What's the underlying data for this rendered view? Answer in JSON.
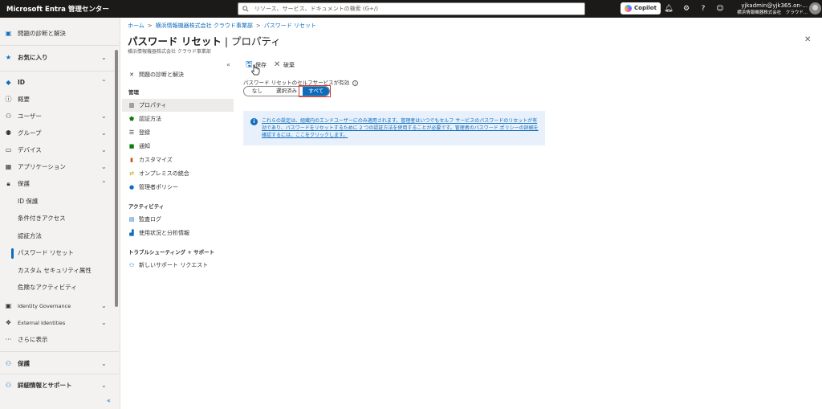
{
  "topbar": {
    "brand": "Microsoft Entra 管理センター",
    "search_placeholder": "リソース、サービス、ドキュメントの検索 (G+/)",
    "copilot_label": "Copilot",
    "account_email": "yjkadmin@yjk365.on-...",
    "account_org": "横浜情報機器株式会社　クラウド..."
  },
  "leftnav": {
    "items": [
      {
        "label": "問題の診断と解決",
        "icon": "diagnose-icon"
      },
      {
        "label": "お気に入り",
        "icon": "star-icon"
      },
      {
        "label": "ID",
        "icon": "identity-icon"
      },
      {
        "label": "概要",
        "icon": "info-icon"
      },
      {
        "label": "ユーザー",
        "icon": "user-icon"
      },
      {
        "label": "グループ",
        "icon": "group-icon"
      },
      {
        "label": "デバイス",
        "icon": "device-icon"
      },
      {
        "label": "アプリケーション",
        "icon": "apps-icon"
      },
      {
        "label": "保護",
        "icon": "lock-icon"
      },
      {
        "label": "ID 保護"
      },
      {
        "label": "条件付きアクセス"
      },
      {
        "label": "認証方法"
      },
      {
        "label": "パスワード リセット"
      },
      {
        "label": "カスタム セキュリティ属性"
      },
      {
        "label": "危険なアクティビティ"
      },
      {
        "label": "Identity Governance",
        "icon": "governance-icon"
      },
      {
        "label": "External Identities",
        "icon": "external-icon"
      },
      {
        "label": "さらに表示",
        "icon": "more-icon"
      },
      {
        "label": "保護",
        "icon": "protect-icon"
      },
      {
        "label": "詳細情報とサポート",
        "icon": "learn-icon"
      }
    ],
    "collapse_glyph": "«"
  },
  "breadcrumb": [
    "ホーム",
    "横浜情報機器株式会社 クラウド事業部",
    "パスワード リセット"
  ],
  "page": {
    "title_main": "パスワード リセット",
    "title_sep": " | ",
    "title_sub": "プロパティ",
    "more": "···",
    "subtitle": "横浜情報機器株式会社 クラウド事業部",
    "close": "✕"
  },
  "resource_nav": {
    "collapse": "«",
    "top_item": "問題の診断と解決",
    "section_manage": "管理",
    "manage_items": [
      "プロパティ",
      "認証方法",
      "登録",
      "通知",
      "カスタマイズ",
      "オンプレミスの統合",
      "管理者ポリシー"
    ],
    "section_activity": "アクティビティ",
    "activity_items": [
      "監査ログ",
      "使用状況と分析情報"
    ],
    "section_support": "トラブルシューティング + サポート",
    "support_items": [
      "新しいサポート リクエスト"
    ]
  },
  "toolbar": {
    "save_label": "保存",
    "discard_label": "破棄"
  },
  "setting": {
    "label": "パスワード リセットのセルフサービスが有効",
    "options": [
      "なし",
      "選択済み",
      "すべて"
    ],
    "selected": "すべて"
  },
  "info_banner": {
    "text": "これらの設定は、組織内のエンドユーザーにのみ適用されます。管理者はいつでもセルフ サービスのパスワードのリセットが有効であり、パスワードをリセットするために 2 つの認証方法を使用することが必要です。管理者のパスワード ポリシーの詳細を確認するには、ここをクリックします。"
  },
  "colors": {
    "accent": "#0f6cbd",
    "topbar": "#1b1a19",
    "highlight": "#d13438"
  }
}
